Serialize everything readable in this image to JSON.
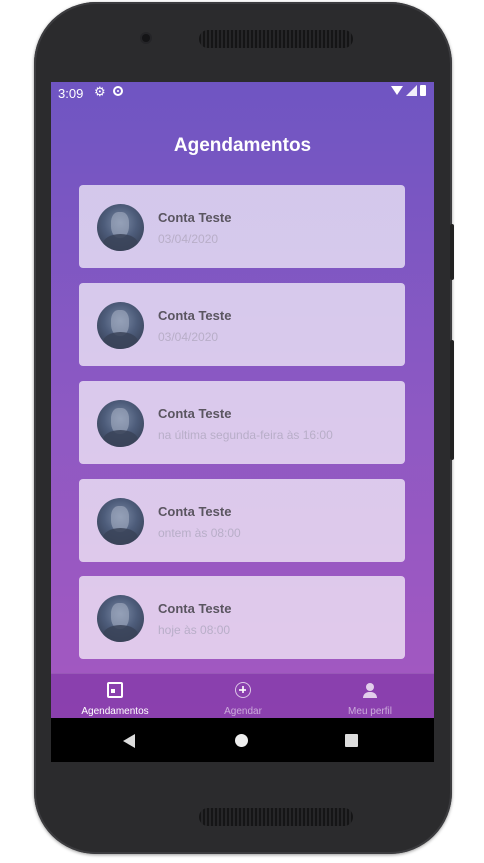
{
  "status_bar": {
    "time": "3:09"
  },
  "page": {
    "title": "Agendamentos"
  },
  "appointments": [
    {
      "name": "Conta Teste",
      "when": "03/04/2020"
    },
    {
      "name": "Conta Teste",
      "when": "03/04/2020"
    },
    {
      "name": "Conta Teste",
      "when": "na última segunda-feira às 16:00"
    },
    {
      "name": "Conta Teste",
      "when": "ontem às 08:00"
    },
    {
      "name": "Conta Teste",
      "when": "hoje às 08:00"
    }
  ],
  "bottom_nav": {
    "items": [
      {
        "label": "Agendamentos",
        "icon": "calendar-icon",
        "active": true
      },
      {
        "label": "Agendar",
        "icon": "add-circle-icon",
        "active": false
      },
      {
        "label": "Meu perfil",
        "icon": "person-icon",
        "active": false
      }
    ]
  },
  "colors": {
    "gradient_top": "#6f55c2",
    "gradient_bottom": "#a857c0",
    "card_bg": "#e9dff0"
  }
}
